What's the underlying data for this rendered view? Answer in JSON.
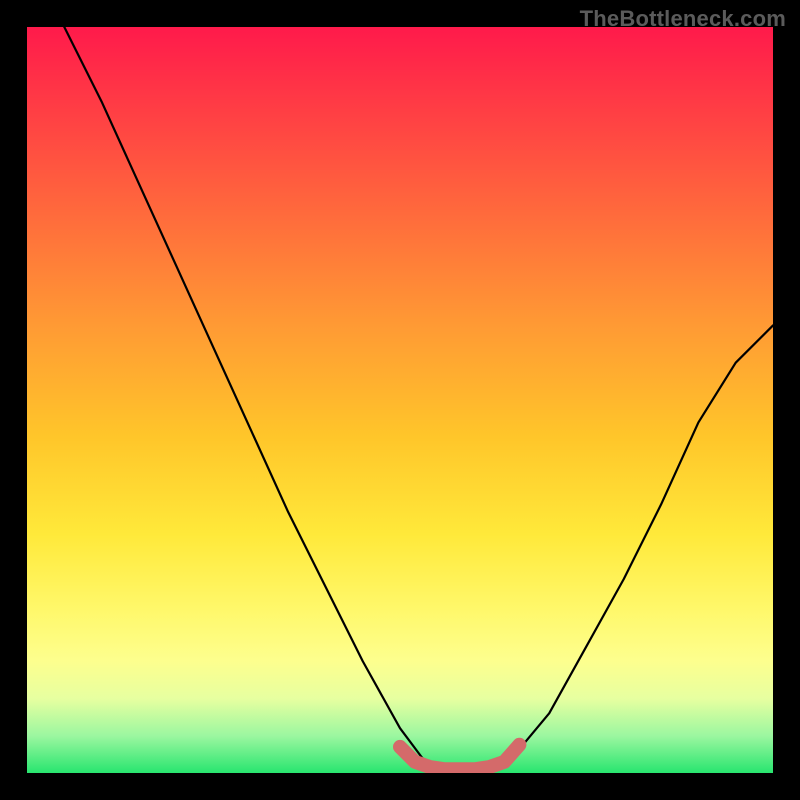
{
  "watermark": "TheBottleneck.com",
  "chart_data": {
    "type": "line",
    "title": "",
    "xlabel": "",
    "ylabel": "",
    "xlim": [
      0,
      100
    ],
    "ylim": [
      0,
      100
    ],
    "grid": false,
    "series": [
      {
        "name": "bottleneck-curve",
        "x": [
          5,
          10,
          15,
          20,
          25,
          30,
          35,
          40,
          45,
          50,
          53,
          56,
          59,
          62,
          65,
          70,
          75,
          80,
          85,
          90,
          95,
          100
        ],
        "y": [
          100,
          90,
          79,
          68,
          57,
          46,
          35,
          25,
          15,
          6,
          2,
          0,
          0,
          0,
          2,
          8,
          17,
          26,
          36,
          47,
          55,
          60
        ],
        "color": "#000000"
      },
      {
        "name": "optimal-range-marker",
        "x": [
          50,
          52,
          54,
          56,
          58,
          60,
          62,
          64,
          66
        ],
        "y": [
          3.5,
          1.5,
          0.8,
          0.5,
          0.5,
          0.5,
          0.8,
          1.5,
          3.8
        ],
        "color": "#d46a6a"
      }
    ],
    "background_gradient": {
      "type": "vertical",
      "stops": [
        {
          "pos": 0.0,
          "color": "#ff1a4b"
        },
        {
          "pos": 0.1,
          "color": "#ff3a45"
        },
        {
          "pos": 0.25,
          "color": "#ff6a3c"
        },
        {
          "pos": 0.4,
          "color": "#ff9a34"
        },
        {
          "pos": 0.55,
          "color": "#ffc62a"
        },
        {
          "pos": 0.68,
          "color": "#ffe93a"
        },
        {
          "pos": 0.78,
          "color": "#fff86a"
        },
        {
          "pos": 0.85,
          "color": "#fdff8e"
        },
        {
          "pos": 0.9,
          "color": "#e7ffa0"
        },
        {
          "pos": 0.95,
          "color": "#9cf7a0"
        },
        {
          "pos": 1.0,
          "color": "#28e56f"
        }
      ]
    }
  }
}
